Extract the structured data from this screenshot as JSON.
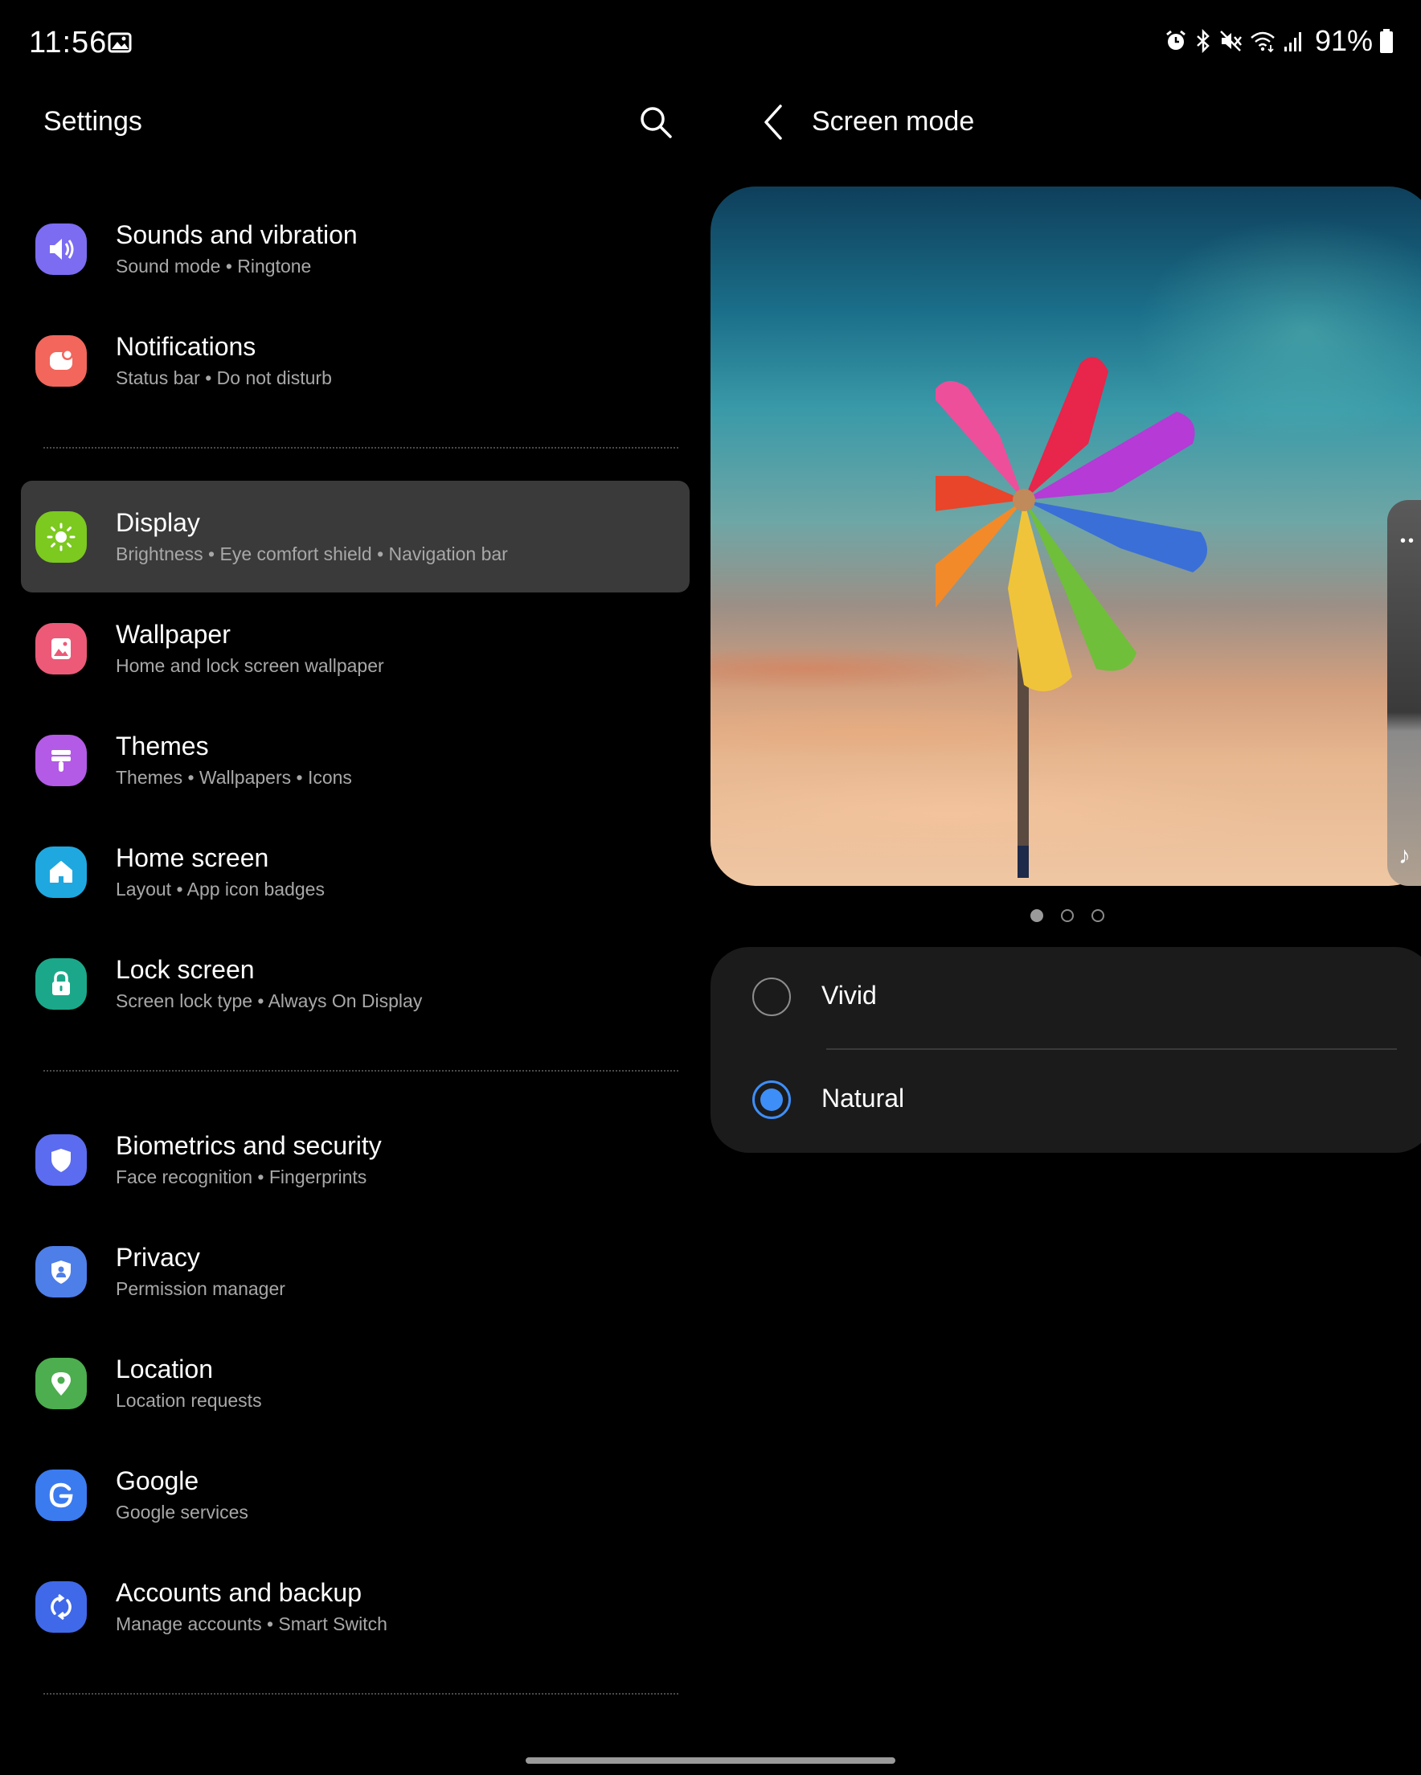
{
  "status_bar": {
    "time": "11:56",
    "battery": "91%",
    "icons": [
      "gallery-icon",
      "alarm-icon",
      "bluetooth-icon",
      "mute-icon",
      "wifi-icon",
      "signal-icon",
      "battery-icon"
    ]
  },
  "left_pane": {
    "title": "Settings",
    "items": [
      {
        "title": "Sounds and vibration",
        "subtitle": "Sound mode  •  Ringtone",
        "icon": "speaker-icon",
        "color": "#7b6cf2"
      },
      {
        "title": "Notifications",
        "subtitle": "Status bar  •  Do not disturb",
        "icon": "notification-icon",
        "color": "#f2665c"
      },
      {
        "title": "Display",
        "subtitle": "Brightness  •  Eye comfort shield  •  Navigation bar",
        "icon": "sun-icon",
        "color": "#7cc91f"
      },
      {
        "title": "Wallpaper",
        "subtitle": "Home and lock screen wallpaper",
        "icon": "image-icon",
        "color": "#ec5a78"
      },
      {
        "title": "Themes",
        "subtitle": "Themes  •  Wallpapers  •  Icons",
        "icon": "brush-icon",
        "color": "#b35ae6"
      },
      {
        "title": "Home screen",
        "subtitle": "Layout  •  App icon badges",
        "icon": "home-icon",
        "color": "#1fa8e0"
      },
      {
        "title": "Lock screen",
        "subtitle": "Screen lock type  •  Always On Display",
        "icon": "lock-icon",
        "color": "#1ba88a"
      },
      {
        "title": "Biometrics and security",
        "subtitle": "Face recognition  •  Fingerprints",
        "icon": "shield-icon",
        "color": "#5b6cf0"
      },
      {
        "title": "Privacy",
        "subtitle": "Permission manager",
        "icon": "privacy-shield-icon",
        "color": "#4e7ee8"
      },
      {
        "title": "Location",
        "subtitle": "Location requests",
        "icon": "location-pin-icon",
        "color": "#4cae4f"
      },
      {
        "title": "Google",
        "subtitle": "Google services",
        "icon": "google-icon",
        "color": "#3b7bf0"
      },
      {
        "title": "Accounts and backup",
        "subtitle": "Manage accounts  •  Smart Switch",
        "icon": "sync-icon",
        "color": "#3f69e8"
      }
    ],
    "selected_index": 2
  },
  "right_pane": {
    "title": "Screen mode",
    "pager": {
      "count": 3,
      "active": 0
    },
    "options": [
      {
        "label": "Vivid",
        "checked": false
      },
      {
        "label": "Natural",
        "checked": true
      }
    ],
    "accent": "#3e8ef7"
  }
}
